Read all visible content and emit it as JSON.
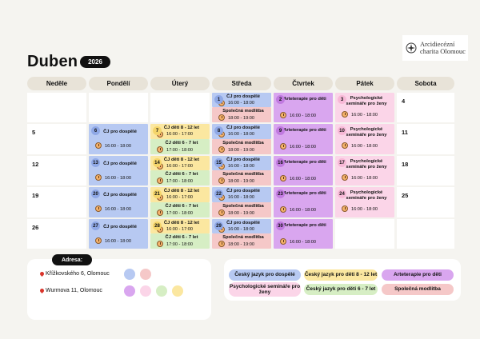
{
  "logo": {
    "line1": "Arcidiecézní",
    "line2": "charita Olomouc"
  },
  "header": {
    "month": "Duben",
    "year": "2026"
  },
  "days": [
    "Neděle",
    "Pondělí",
    "Úterý",
    "Středa",
    "Čtvrtek",
    "Pátek",
    "Sobota"
  ],
  "colors": {
    "blue": "#b7c9f2",
    "yellow": "#fbe7a0",
    "green": "#d6eec4",
    "pink": "#f5c8c8",
    "purple": "#d9a6ef",
    "lightpink": "#fbd5e8"
  },
  "rows": [
    {
      "sun": "",
      "mon": "",
      "tue": "",
      "wed": "1",
      "thu": "2",
      "fri": "3",
      "sat": "4"
    },
    {
      "sun": "5",
      "mon": "6",
      "tue": "7",
      "wed": "8",
      "thu": "9",
      "fri": "10",
      "sat": "11"
    },
    {
      "sun": "12",
      "mon": "13",
      "tue": "14",
      "wed": "15",
      "thu": "16",
      "fri": "17",
      "sat": "18"
    },
    {
      "sun": "19",
      "mon": "20",
      "tue": "21",
      "wed": "22",
      "thu": "23",
      "fri": "24",
      "sat": "25"
    },
    {
      "sun": "26",
      "mon": "27",
      "tue": "28",
      "wed": "29",
      "thu": "30",
      "fri": "",
      "sat": ""
    }
  ],
  "events": {
    "cj_adult": {
      "title": "ČJ pro dospělé",
      "time": "16:00 - 18:00"
    },
    "cj_8_12": {
      "title": "ČJ děti 8 - 12 let",
      "time": "16:00 - 17:00"
    },
    "cj_6_7": {
      "title": "ČJ děti 6 - 7 let",
      "time": "17:00 - 18:00"
    },
    "prayer": {
      "title": "Společná modlitba",
      "time": "18:00 - 19:00"
    },
    "art": {
      "title": "Arteterapie pro děti",
      "time": "16:00 - 18:00"
    },
    "psych": {
      "title": "Psychologické semináře pro ženy",
      "time": "16:00 - 18:00"
    }
  },
  "address": {
    "label": "Adresa:",
    "items": [
      "Křížkovského 6, Olomouc",
      "Wurmova 11, Olomouc"
    ]
  },
  "legend": [
    {
      "label": "Český jazyk pro dospělé",
      "color": "#b7c9f2"
    },
    {
      "label": "Český jazyk pro děti 8 - 12 let",
      "color": "#fbe7a0"
    },
    {
      "label": "Arteterapie pro děti",
      "color": "#d9a6ef"
    },
    {
      "label": "Psychologické semináře pro ženy",
      "color": "#fbd5e8"
    },
    {
      "label": "Český jazyk pro děti 6 - 7 let",
      "color": "#d6eec4"
    },
    {
      "label": "Společná modlitba",
      "color": "#f5c8c8"
    }
  ]
}
